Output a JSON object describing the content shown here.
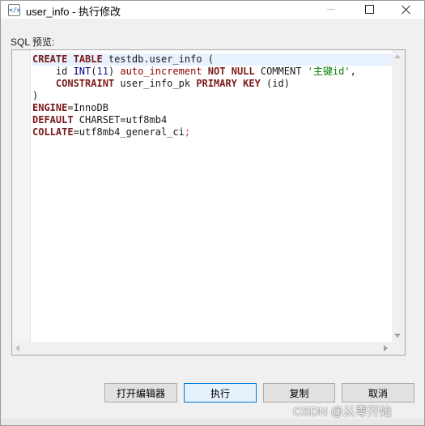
{
  "window": {
    "title": "user_info - 执行修改",
    "icon": "sql-file-icon"
  },
  "preview": {
    "label": "SQL 预览:"
  },
  "sql": {
    "lines": [
      "CREATE TABLE testdb.user_info (",
      "    id INT(11) auto_increment NOT NULL COMMENT '主键id',",
      "    CONSTRAINT user_info_pk PRIMARY KEY (id)",
      ")",
      "ENGINE=InnoDB",
      "DEFAULT CHARSET=utf8mb4",
      "COLLATE=utf8mb4_general_ci;"
    ]
  },
  "buttons": {
    "open_editor": "打开编辑器",
    "execute": "执行",
    "copy": "复制",
    "cancel": "取消"
  },
  "watermark": "CSDN @从零开始",
  "colors": {
    "keyword": "#7b1a1a",
    "type": "#00008b",
    "string": "#008000",
    "highlight_line": "#e8f2fe",
    "focus_border": "#0078d7"
  }
}
